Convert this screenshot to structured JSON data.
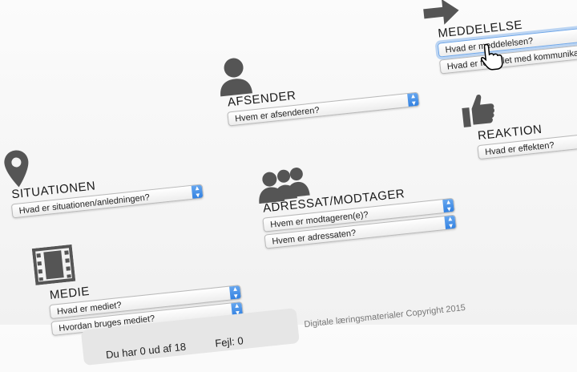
{
  "sections": {
    "meddelelse": {
      "label": "MEDDELELSE",
      "select1": "Hvad er meddelelsen?",
      "select2": "Hvad er formålet med kommunikationen?"
    },
    "afsender": {
      "label": "AFSENDER",
      "select1": "Hvem er afsenderen?"
    },
    "situationen": {
      "label": "SITUATIONEN",
      "select1": "Hvad er situationen/anledningen?"
    },
    "reaktion": {
      "label": "REAKTION",
      "select1": "Hvad er effekten?"
    },
    "adressat": {
      "label": "ADRESSAT/MODTAGER",
      "select1": "Hvem er modtageren(e)?",
      "select2": "Hvem er adressaten?"
    },
    "medie": {
      "label": "MEDIE",
      "select1": "Hvad er mediet?",
      "select2": "Hvordan bruges mediet?"
    }
  },
  "footer": {
    "copyright": "Digitale læringsmaterialer Copyright 2015",
    "score": "Du har 0 ud af 18",
    "errors": "Fejl: 0"
  },
  "icons": {
    "meddelelse": "arrow-right-icon",
    "afsender": "person-icon",
    "situationen": "map-pin-icon",
    "reaktion": "thumbs-up-icon",
    "adressat": "group-icon",
    "medie": "film-icon"
  }
}
